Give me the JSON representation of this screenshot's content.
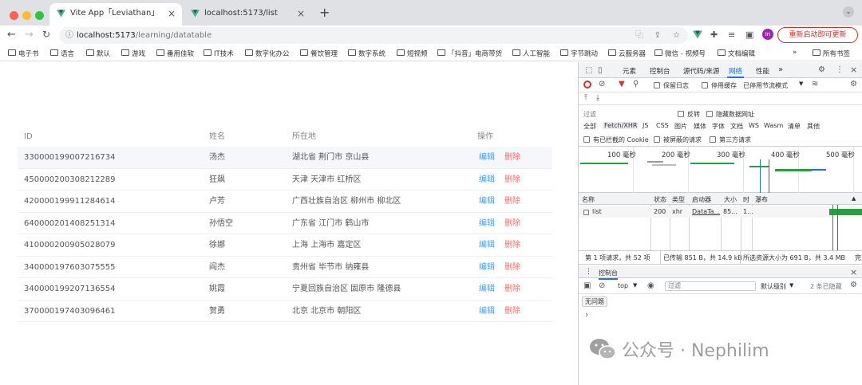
{
  "browser": {
    "tabs": [
      {
        "title": "Vite App「Leviathan」"
      },
      {
        "title": "localhost:5173/list"
      }
    ],
    "url_host": "localhost:5173",
    "url_path": "/learning/datatable",
    "profile_initial": "In",
    "restart_label": "重新启动即可更新",
    "bookmarks": [
      "电子书",
      "语言",
      "默认",
      "游戏",
      "番用佳软",
      "IT技术",
      "数字化办公",
      "餐饮管理",
      "数字系统",
      "短视频",
      "「抖音」电商带货",
      "人工智能",
      "字节跳动",
      "云服务器",
      "微信 - 视频号",
      "文档编辑"
    ],
    "bookmarks_overflow": "»",
    "all_bookmarks": "所有书签"
  },
  "table": {
    "headers": {
      "id": "ID",
      "name": "姓名",
      "location": "所在地",
      "actions": "操作"
    },
    "edit_label": "编辑",
    "delete_label": "删除",
    "rows": [
      {
        "id": "330000199007216734",
        "name": "汤杰",
        "location": "湖北省 荆门市 京山县"
      },
      {
        "id": "450000200308212289",
        "name": "狂飙",
        "location": "天津 天津市 红桥区"
      },
      {
        "id": "420000199911284614",
        "name": "卢芳",
        "location": "广西壮族自治区 柳州市 柳北区"
      },
      {
        "id": "640000201408251314",
        "name": "孙悟空",
        "location": "广东省 江门市 鹤山市"
      },
      {
        "id": "410000200905028079",
        "name": "徐娜",
        "location": "上海 上海市 嘉定区"
      },
      {
        "id": "340000197603075555",
        "name": "阎杰",
        "location": "贵州省 毕节市 纳雍县"
      },
      {
        "id": "340000199207136554",
        "name": "姚霞",
        "location": "宁夏回族自治区 固原市 隆德县"
      },
      {
        "id": "370000197403096461",
        "name": "贺勇",
        "location": "北京 北京市 朝阳区"
      }
    ]
  },
  "devtools": {
    "tabs": [
      "元素",
      "控制台",
      "源代码/来源",
      "网络",
      "性能"
    ],
    "selected_tab": "网络",
    "preserve_log": "保留日志",
    "disable_cache": "停用缓存",
    "throttle": "已停用节流模式",
    "filter_placeholder": "过滤",
    "invert": "反转",
    "hide_data_urls": "隐藏数据网址",
    "filter_types": [
      "全部",
      "Fetch/XHR",
      "JS",
      "CSS",
      "图片",
      "媒体",
      "字体",
      "文档",
      "WS",
      "Wasm",
      "清单",
      "其他"
    ],
    "selected_type": "Fetch/XHR",
    "blocked_cookies": "有已拦截的 Cookie",
    "blocked_requests": "被屏蔽的请求",
    "third_party": "第三方请求",
    "timeline_ticks": [
      "100 毫秒",
      "200 毫秒",
      "300 毫秒",
      "400 毫秒",
      "500 毫秒"
    ],
    "columns": [
      "名称",
      "状态",
      "类型",
      "启动器",
      "大小",
      "时",
      "瀑布"
    ],
    "request": {
      "name": "list",
      "status": "200",
      "type": "xhr",
      "initiator": "DataTa...",
      "size": "85...",
      "time": "1..."
    },
    "status_bar": {
      "requests": "第 1 项请求，共 52 项",
      "transferred": "已传输 851 B，共 14.9 kB",
      "resources": "所选资源大小为 691 B，共 3.4 MB",
      "more": "完"
    },
    "drawer_title": "控制台",
    "console": {
      "context": "top",
      "filter_placeholder": "过滤",
      "level": "默认级别",
      "hidden": "2 条已隐藏",
      "issues": "无问题",
      "prompt": "›"
    }
  },
  "watermark": "公众号 · Nephilim",
  "colors": {
    "link": "#409eff",
    "danger": "#f56c6c",
    "devtools_accent": "#1a73e8"
  }
}
